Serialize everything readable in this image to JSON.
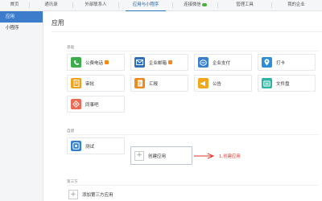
{
  "topnav": {
    "tabs": [
      "首页",
      "通讯录",
      "外部联系人",
      "应用与小程序",
      "连接微信",
      "管理工具",
      "我的企业"
    ],
    "active_index": 3
  },
  "sidebar": {
    "items": [
      "应用",
      "小程序"
    ],
    "active_index": 0
  },
  "main": {
    "title": "应用",
    "sections": {
      "basic": "基础",
      "custom": "自建",
      "third_party": "第三方"
    },
    "apps": [
      {
        "name": "公费电话",
        "color": "#3aae4a",
        "icon": "phone-icon",
        "badge": true
      },
      {
        "name": "企业邮箱",
        "color": "#2f6fc1",
        "icon": "mail-icon",
        "badge": true
      },
      {
        "name": "企业支付",
        "color": "#3a80d2",
        "icon": "payment-icon",
        "badge": false
      },
      {
        "name": "打卡",
        "color": "#2c8ed8",
        "icon": "location-icon",
        "badge": false
      },
      {
        "name": "审批",
        "color": "#f1a11e",
        "icon": "approval-icon",
        "badge": false
      },
      {
        "name": "汇报",
        "color": "#f08a1c",
        "icon": "report-icon",
        "badge": false
      },
      {
        "name": "公告",
        "color": "#f3a61c",
        "icon": "megaphone-icon",
        "badge": false
      },
      {
        "name": "文件盘",
        "color": "#2fb5a6",
        "icon": "file-icon",
        "badge": false
      },
      {
        "name": "同事吧",
        "color": "#ee6a55",
        "icon": "colleague-icon",
        "badge": false
      }
    ],
    "custom_app": {
      "name": "测试",
      "color": "#3180d6",
      "icon": "test-app-icon"
    },
    "create_app_label": "创建应用",
    "annotation": "1.创建应用",
    "add_third_party_label": "添加第三方应用"
  },
  "colors": {
    "accent": "#3d7cca",
    "annotation": "#e2352d"
  }
}
